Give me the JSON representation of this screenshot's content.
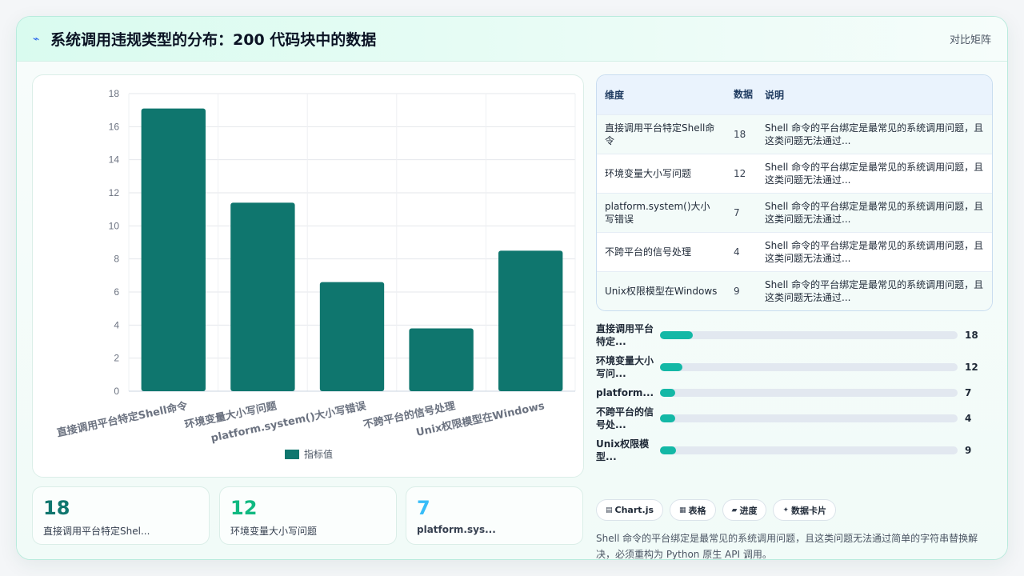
{
  "header": {
    "logo_icon": "⌁",
    "title": "系统调用违规类型的分布：200 代码块中的数据",
    "right_label": "对比矩阵"
  },
  "colors": {
    "bar": "#0f766e",
    "progress": "#14b8a6",
    "stat_1": "#0f766e",
    "stat_2": "#10b981",
    "stat_3": "#38bdf8"
  },
  "chart_data": {
    "type": "bar",
    "categories": [
      "直接调用平台特定Shell命令",
      "环境变量大小写问题",
      "platform.system()大小写错误",
      "不跨平台的信号处理",
      "Unix权限模型在Windows"
    ],
    "series": [
      {
        "name": "指标值",
        "values": [
          17.1,
          11.4,
          6.6,
          3.8,
          8.5
        ]
      }
    ],
    "ylim": [
      0,
      18
    ],
    "yticks": [
      0,
      2,
      4,
      6,
      8,
      10,
      12,
      14,
      16,
      18
    ],
    "grid": true,
    "legend": "bottom"
  },
  "table": {
    "headers": [
      "维度",
      "数据",
      "说明"
    ],
    "rows": [
      {
        "name": "直接调用平台特定Shell命令",
        "value": "18",
        "desc": "Shell 命令的平台绑定是最常见的系统调用问题，且这类问题无法通过..."
      },
      {
        "name": "环境变量大小写问题",
        "value": "12",
        "desc": "Shell 命令的平台绑定是最常见的系统调用问题，且这类问题无法通过..."
      },
      {
        "name": "platform.system()大小写错误",
        "value": "7",
        "desc": "Shell 命令的平台绑定是最常见的系统调用问题，且这类问题无法通过..."
      },
      {
        "name": "不跨平台的信号处理",
        "value": "4",
        "desc": "Shell 命令的平台绑定是最常见的系统调用问题，且这类问题无法通过..."
      },
      {
        "name": "Unix权限模型在Windows",
        "value": "9",
        "desc": "Shell 命令的平台绑定是最常见的系统调用问题，且这类问题无法通过..."
      }
    ]
  },
  "progress": [
    {
      "label": "直接调用平台特定...",
      "value": 18,
      "display": "18",
      "fraction": 0.11
    },
    {
      "label": "环境变量大小写问...",
      "value": 12,
      "display": "12",
      "fraction": 0.075
    },
    {
      "label": "platform...",
      "value": 7,
      "display": "7",
      "fraction": 0.05
    },
    {
      "label": "不跨平台的信号处...",
      "value": 4,
      "display": "4",
      "fraction": 0.05
    },
    {
      "label": "Unix权限模型...",
      "value": 9,
      "display": "9",
      "fraction": 0.055
    }
  ],
  "stats": [
    {
      "value": "18",
      "label": "直接调用平台特定Shel..."
    },
    {
      "value": "12",
      "label": "环境变量大小写问题"
    },
    {
      "value": "7",
      "label": "platform.sys..."
    }
  ],
  "tags": [
    {
      "icon": "▤",
      "label": "Chart.js"
    },
    {
      "icon": "▦",
      "label": "表格"
    },
    {
      "icon": "▰",
      "label": "进度"
    },
    {
      "icon": "✦",
      "label": "数据卡片"
    }
  ],
  "note": "Shell 命令的平台绑定是最常见的系统调用问题，且这类问题无法通过简单的字符串替换解决，必须重构为 Python 原生 API 调用。"
}
